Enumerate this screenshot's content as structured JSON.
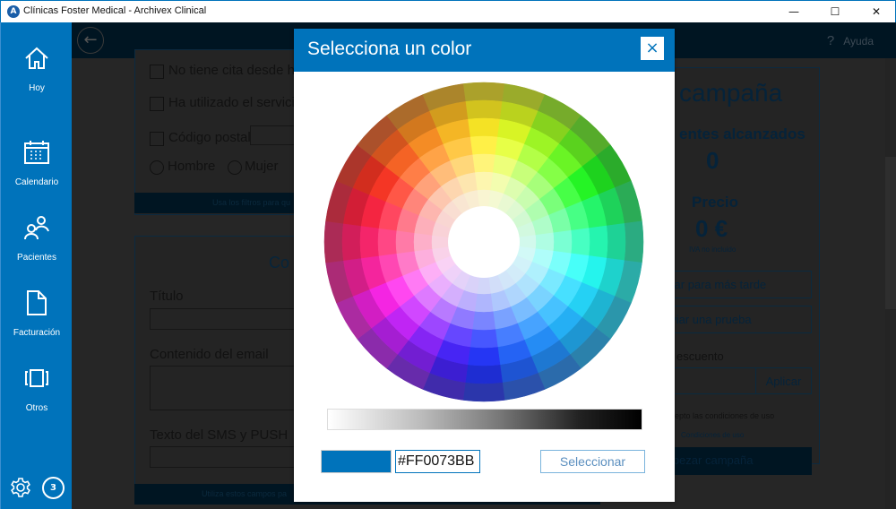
{
  "window": {
    "title": "Clínicas Foster Medical - Archivex Clinical",
    "logo": "A",
    "controls": [
      "minimize-icon",
      "maximize-icon",
      "close-icon"
    ]
  },
  "sidebar": {
    "items": [
      {
        "label": "Hoy",
        "icon": "home-icon"
      },
      {
        "label": "Calendario",
        "icon": "calendar-icon"
      },
      {
        "label": "Pacientes",
        "icon": "people-icon"
      },
      {
        "label": "Facturación",
        "icon": "document-icon"
      },
      {
        "label": "Otros",
        "icon": "carousel-icon"
      }
    ],
    "settings_icon": "gear-icon",
    "notifications_count": "3",
    "accent": "#0073bb"
  },
  "header": {
    "help_icon": "?",
    "help_label": "Ayuda"
  },
  "filters": {
    "no_cita": "No tiene cita desde ha",
    "servicio": "Ha utilizado el servicio",
    "codigo_postal": "Código postal",
    "hombre": "Hombre",
    "mujer": "Mujer",
    "footer": "Usa los filtros para qu"
  },
  "content": {
    "heading": "Co",
    "titulo": "Título",
    "email": "Contenido del email",
    "sms": "Texto del SMS y PUSH",
    "footer": "Utiliza estos campos pa"
  },
  "summary": {
    "heading": "campaña",
    "reached_label": "entes alcanzados",
    "reached_value": "0",
    "price_label": "Precio",
    "price_value": "0 €",
    "tax_note": "IVA no incluido",
    "save": "rdar para más tarde",
    "test": "nviar una prueba",
    "discount_label": "escuento",
    "apply": "Aplicar",
    "accept": "epto las condiciones de uso",
    "terms": "Condiciones de uso",
    "start": "mpezar campaña"
  },
  "dialog": {
    "title": "Selecciona un color",
    "close_icon": "×",
    "hex_value": "#FF0073BB",
    "selected_color": "#0073bb",
    "select_label": "Seleccionar"
  }
}
